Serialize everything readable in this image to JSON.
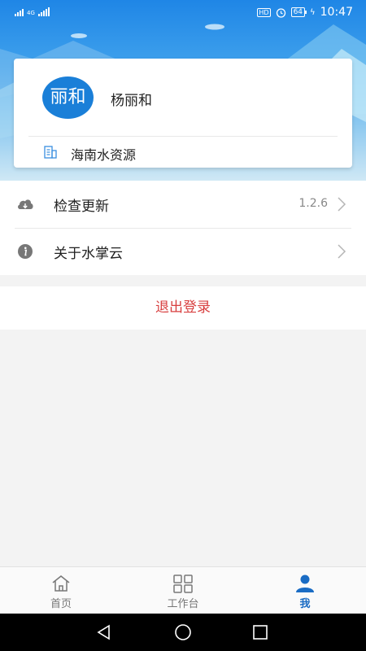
{
  "status_bar": {
    "network": "4G",
    "hd_badge": "HD",
    "battery": "64",
    "time": "10:47"
  },
  "profile": {
    "avatar_text": "丽和",
    "name": "杨丽和",
    "organization": "海南水资源"
  },
  "menu": {
    "items": [
      {
        "label": "检查更新",
        "value": "1.2.6",
        "icon": "cloud-download-icon"
      },
      {
        "label": "关于水掌云",
        "value": "",
        "icon": "info-icon"
      }
    ],
    "logout_label": "退出登录"
  },
  "tabbar": {
    "tabs": [
      {
        "label": "首页",
        "icon": "home-icon",
        "active": false
      },
      {
        "label": "工作台",
        "icon": "grid-icon",
        "active": false
      },
      {
        "label": "我",
        "icon": "person-icon",
        "active": true
      }
    ]
  },
  "colors": {
    "accent": "#1a7fd8",
    "logout": "#d84040",
    "active_tab": "#1a6cc4"
  }
}
